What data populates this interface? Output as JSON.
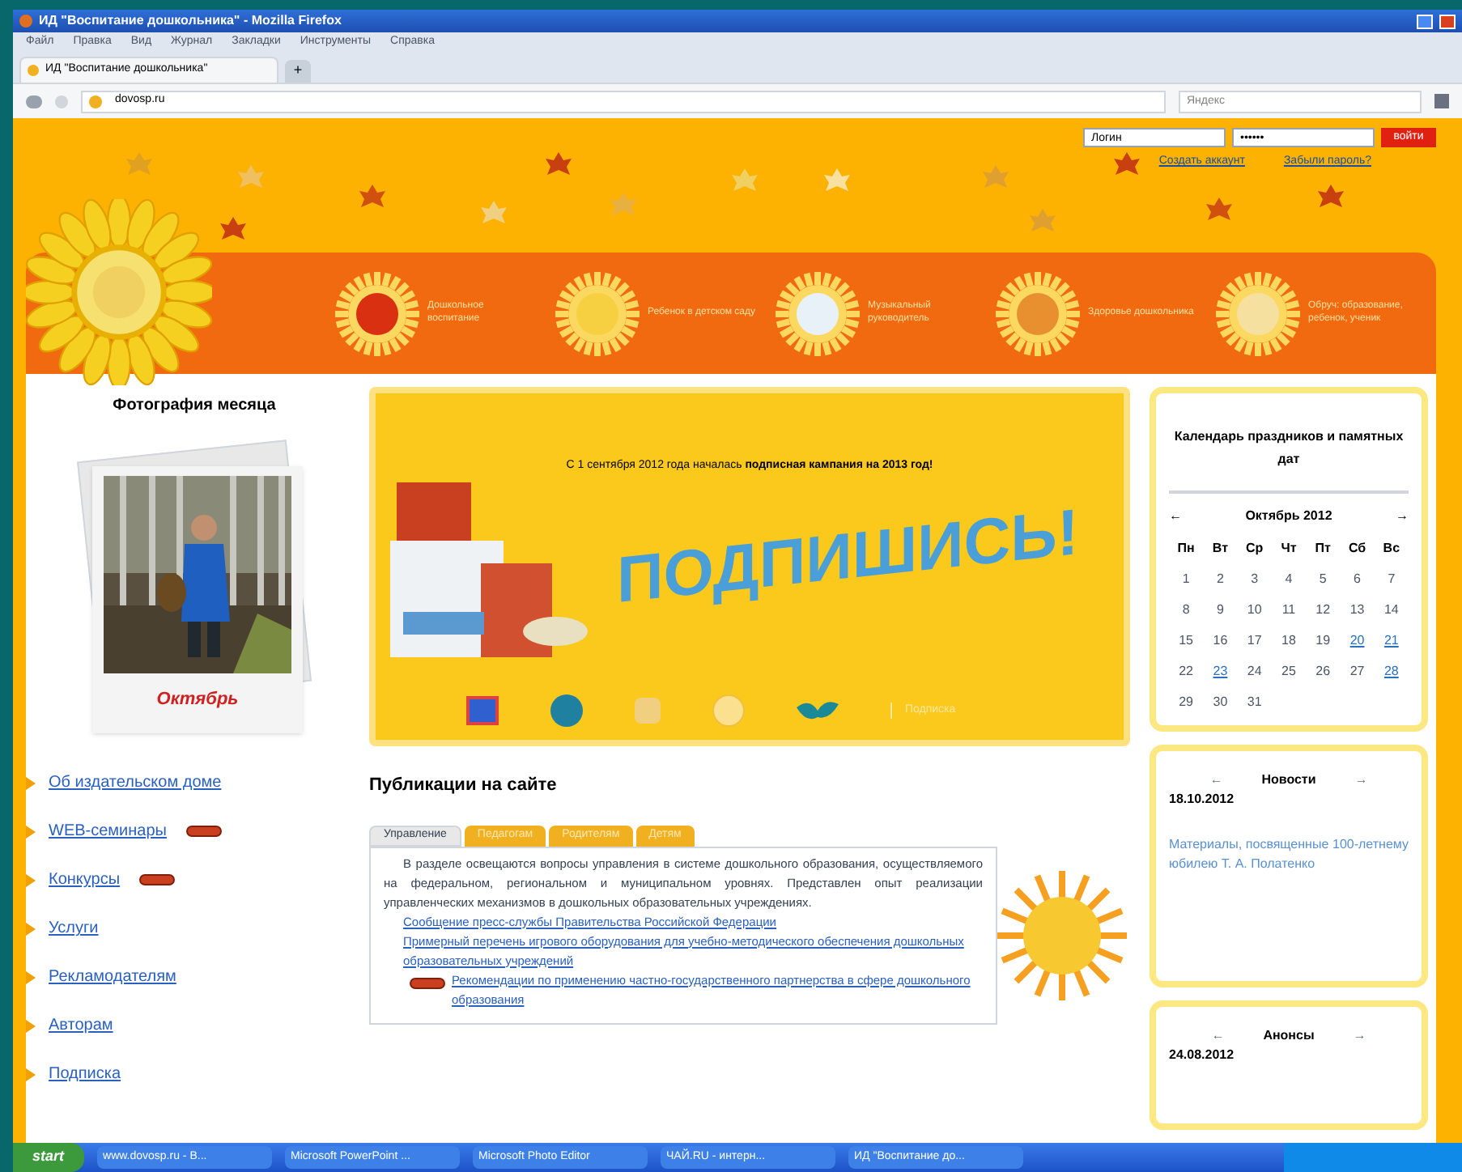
{
  "window": {
    "title": "ИД \"Воспитание дошкольника\" - Mozilla Firefox"
  },
  "menu": [
    "Файл",
    "Правка",
    "Вид",
    "Журнал",
    "Закладки",
    "Инструменты",
    "Справка"
  ],
  "browser_tabs": [
    {
      "label": "ИД \"Воспитание дошкольника\"",
      "selected": true
    }
  ],
  "new_tab": "+",
  "address": "dovosp.ru",
  "search": {
    "placeholder": "Яндекс"
  },
  "login": {
    "username": "Логин",
    "password": "••••••",
    "button": "войти",
    "links": [
      "Создать аккаунт",
      "Забыли пароль?"
    ]
  },
  "journals": [
    "Дошкольное воспитание",
    "Ребенок в детском саду",
    "Музыкальный руководитель",
    "Здоровье дошкольника",
    "Обруч: образование, ребенок, ученик"
  ],
  "photo_of_month": {
    "title": "Фотография месяца",
    "caption": "Октябрь"
  },
  "nav": [
    {
      "label": "Об издательском доме",
      "badge": false
    },
    {
      "label": "WEB-семинары",
      "badge": true
    },
    {
      "label": "Конкурсы",
      "badge": true
    },
    {
      "label": "Услуги",
      "badge": false
    },
    {
      "label": "Рекламодателям",
      "badge": false
    },
    {
      "label": "Авторам",
      "badge": false
    },
    {
      "label": "Подписка",
      "badge": false
    }
  ],
  "banner": {
    "text": "С 1 сентября 2012 года началась **подписная кампания на 2013 год!**",
    "slogan": "ПОДПИШИСЬ!",
    "bottom_link": "Подписка"
  },
  "publications": {
    "title": "Публикации на сайте",
    "tabs": [
      {
        "label": "Управление",
        "selected": true
      },
      {
        "label": "Педагогам",
        "selected": false
      },
      {
        "label": "Родителям",
        "selected": false
      },
      {
        "label": "Детям",
        "selected": false
      }
    ],
    "intro": "В разделе освещаются вопросы управления в системе дошкольного образования, осуществляемого на федеральном, региональном и муниципальном уровнях. Представлен опыт реализации управленческих механизмов в дошкольных образовательных учреждениях.",
    "links": [
      {
        "label": "Сообщение пресс-службы Правительства Российской Федерации",
        "badge": false
      },
      {
        "label": "Примерный перечень игрового оборудования для учебно-методического обеспечения дошкольных образовательных учреждений",
        "badge": false
      },
      {
        "label": "Рекомендации по применению частно-государственного партнерства в сфере дошкольного образования",
        "badge": true
      }
    ]
  },
  "calendar": {
    "title": "Календарь праздников и памятных дат",
    "prev": "←",
    "month": "Октябрь 2012",
    "next": "→",
    "weekdays": [
      "Пн",
      "Вт",
      "Ср",
      "Чт",
      "Пт",
      "Сб",
      "Вс"
    ],
    "weeks": [
      [
        {
          "day": "1",
          "link": false
        },
        {
          "day": "2",
          "link": false
        },
        {
          "day": "3",
          "link": false
        },
        {
          "day": "4",
          "link": false
        },
        {
          "day": "5",
          "link": false
        },
        {
          "day": "6",
          "link": false
        },
        {
          "day": "7",
          "link": false
        }
      ],
      [
        {
          "day": "8",
          "link": false
        },
        {
          "day": "9",
          "link": false
        },
        {
          "day": "10",
          "link": false
        },
        {
          "day": "11",
          "link": false
        },
        {
          "day": "12",
          "link": false
        },
        {
          "day": "13",
          "link": false
        },
        {
          "day": "14",
          "link": false
        }
      ],
      [
        {
          "day": "15",
          "link": false
        },
        {
          "day": "16",
          "link": false
        },
        {
          "day": "17",
          "link": false
        },
        {
          "day": "18",
          "link": false
        },
        {
          "day": "19",
          "link": false
        },
        {
          "day": "20",
          "link": true
        },
        {
          "day": "21",
          "link": true
        }
      ],
      [
        {
          "day": "22",
          "link": false
        },
        {
          "day": "23",
          "link": true
        },
        {
          "day": "24",
          "link": false
        },
        {
          "day": "25",
          "link": false
        },
        {
          "day": "26",
          "link": false
        },
        {
          "day": "27",
          "link": false
        },
        {
          "day": "28",
          "link": true
        }
      ],
      [
        {
          "day": "29",
          "link": false
        },
        {
          "day": "30",
          "link": false
        },
        {
          "day": "31",
          "link": false
        }
      ]
    ]
  },
  "news": {
    "prev": "←",
    "title": "Новости",
    "next": "→",
    "date": "18.10.2012",
    "text": "Материалы, посвященные 100-летнему юбилею Т. А. Полатенко"
  },
  "announcements": {
    "prev": "←",
    "title": "Анонсы",
    "next": "→",
    "date": "24.08.2012"
  },
  "taskbar": {
    "start": "start",
    "items": [
      "www.dovosp.ru - B...",
      "Microsoft PowerPoint ...",
      "Microsoft Photo Editor",
      "ЧАЙ.RU - интерн...",
      "ИД \"Воспитание до..."
    ]
  }
}
